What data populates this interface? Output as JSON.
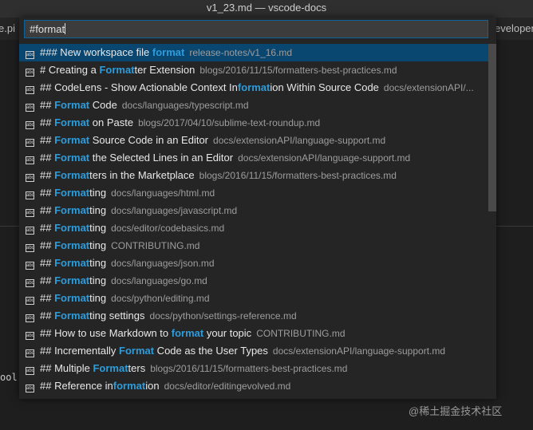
{
  "window": {
    "title": "v1_23.md — vscode-docs"
  },
  "tabs": {
    "left_fragment": "e.pi",
    "right_fragment": "eveloper"
  },
  "editor": {
    "code_fragment": "ool"
  },
  "watermark": "@稀土掘金技术社区",
  "quick_open": {
    "query": "#format",
    "items": [
      {
        "pre": "### New workspace file ",
        "hl": "format",
        "post": "",
        "path": "release-notes/v1_16.md",
        "selected": true
      },
      {
        "pre": "# Creating a ",
        "hl": "Format",
        "post": "ter Extension",
        "path": "blogs/2016/11/15/formatters-best-practices.md"
      },
      {
        "pre": "## CodeLens - Show Actionable Context In",
        "hl": "format",
        "post": "ion Within Source Code",
        "path": "docs/extensionAPI/..."
      },
      {
        "pre": "## ",
        "hl": "Format",
        "post": " Code",
        "path": "docs/languages/typescript.md"
      },
      {
        "pre": "## ",
        "hl": "Format",
        "post": " on Paste",
        "path": "blogs/2017/04/10/sublime-text-roundup.md"
      },
      {
        "pre": "## ",
        "hl": "Format",
        "post": " Source Code in an Editor",
        "path": "docs/extensionAPI/language-support.md"
      },
      {
        "pre": "## ",
        "hl": "Format",
        "post": " the Selected Lines in an Editor",
        "path": "docs/extensionAPI/language-support.md"
      },
      {
        "pre": "## ",
        "hl": "Format",
        "post": "ters in the Marketplace",
        "path": "blogs/2016/11/15/formatters-best-practices.md"
      },
      {
        "pre": "## ",
        "hl": "Format",
        "post": "ting",
        "path": "docs/languages/html.md"
      },
      {
        "pre": "## ",
        "hl": "Format",
        "post": "ting",
        "path": "docs/languages/javascript.md"
      },
      {
        "pre": "## ",
        "hl": "Format",
        "post": "ting",
        "path": "docs/editor/codebasics.md"
      },
      {
        "pre": "## ",
        "hl": "Format",
        "post": "ting",
        "path": "CONTRIBUTING.md"
      },
      {
        "pre": "## ",
        "hl": "Format",
        "post": "ting",
        "path": "docs/languages/json.md"
      },
      {
        "pre": "## ",
        "hl": "Format",
        "post": "ting",
        "path": "docs/languages/go.md"
      },
      {
        "pre": "## ",
        "hl": "Format",
        "post": "ting",
        "path": "docs/python/editing.md"
      },
      {
        "pre": "## ",
        "hl": "Format",
        "post": "ting settings",
        "path": "docs/python/settings-reference.md"
      },
      {
        "pre": "## How to use Markdown to ",
        "hl": "format",
        "post": " your topic",
        "path": "CONTRIBUTING.md"
      },
      {
        "pre": "## Incrementally ",
        "hl": "Format",
        "post": " Code as the User Types",
        "path": "docs/extensionAPI/language-support.md"
      },
      {
        "pre": "## Multiple ",
        "hl": "Format",
        "post": "ters",
        "path": "blogs/2016/11/15/formatters-best-practices.md"
      },
      {
        "pre": "## Reference in",
        "hl": "format",
        "post": "ion",
        "path": "docs/editor/editingevolved.md"
      }
    ],
    "icon": "symbol-string-icon",
    "icon_glyph": "abc"
  },
  "colors": {
    "highlight": "#2d9cdb",
    "selection": "#094771",
    "input_border": "#0e639c"
  }
}
